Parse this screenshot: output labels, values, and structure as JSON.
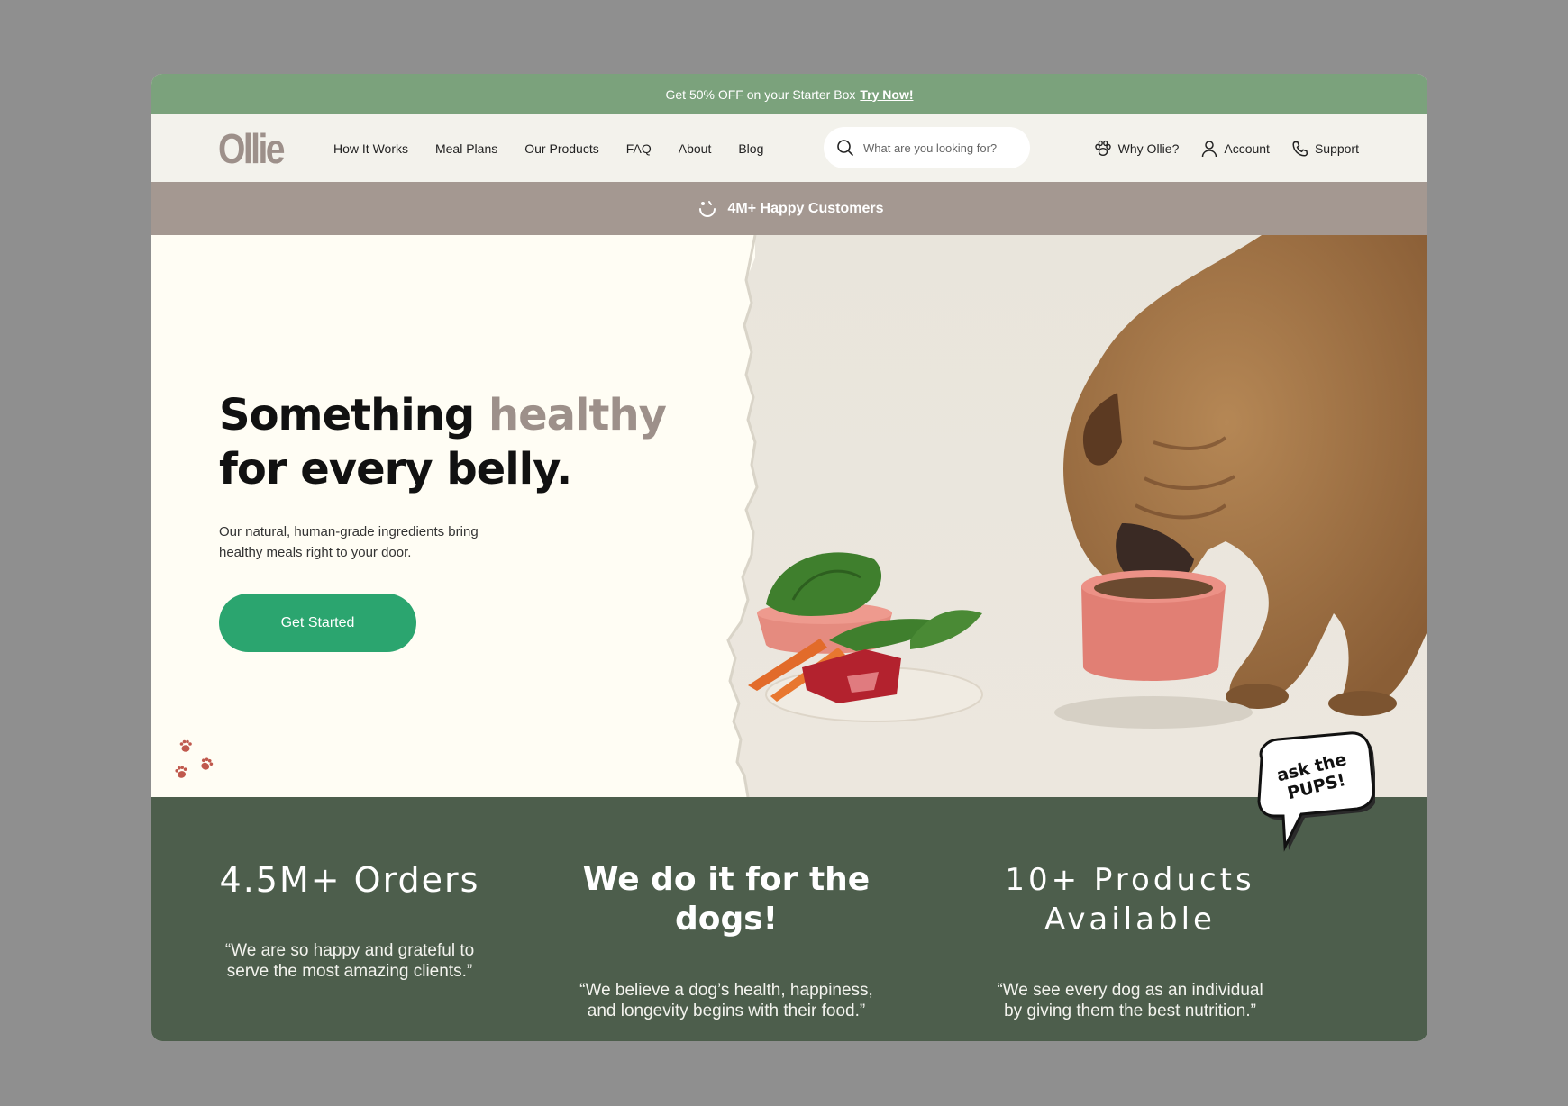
{
  "promo": {
    "text": "Get 50% OFF on your Starter Box",
    "link": "Try Now!"
  },
  "nav": {
    "logo": "Ollie",
    "items": [
      "How It Works",
      "Meal Plans",
      "Our Products",
      "FAQ",
      "About",
      "Blog"
    ],
    "search_placeholder": "What are you looking for?",
    "right": [
      {
        "label": "Why Ollie?",
        "icon": "paw-icon"
      },
      {
        "label": "Account",
        "icon": "user-icon"
      },
      {
        "label": "Support",
        "icon": "phone-icon"
      }
    ]
  },
  "happy": {
    "text": "4M+ Happy Customers",
    "icon": "smile-icon"
  },
  "hero": {
    "title_line1_a": "Something ",
    "title_line1_b": "healthy",
    "title_line2": "for every belly.",
    "subtitle": "Our natural, human-grade ingredients bring healthy meals right to your door.",
    "cta": "Get Started"
  },
  "bubble": {
    "line1": "ask the",
    "line2": "PUPS!"
  },
  "stats": [
    {
      "title": "4.5M+ Orders",
      "quote": "“We are so happy and grateful to serve the most amazing clients.”"
    },
    {
      "title": "We do it for the dogs!",
      "quote": "“We believe a dog’s health, happiness, and longevity begins with their food.”"
    },
    {
      "title": "10+ Products Available",
      "quote": "“We see every dog as an individual by giving them the best nutrition.”"
    }
  ],
  "colors": {
    "promo_bg": "#7ba27c",
    "brand_taupe": "#9d908a",
    "cta_green": "#2ba56f",
    "stats_bg": "#4d5e4c",
    "page_bg": "#fffdf4"
  }
}
